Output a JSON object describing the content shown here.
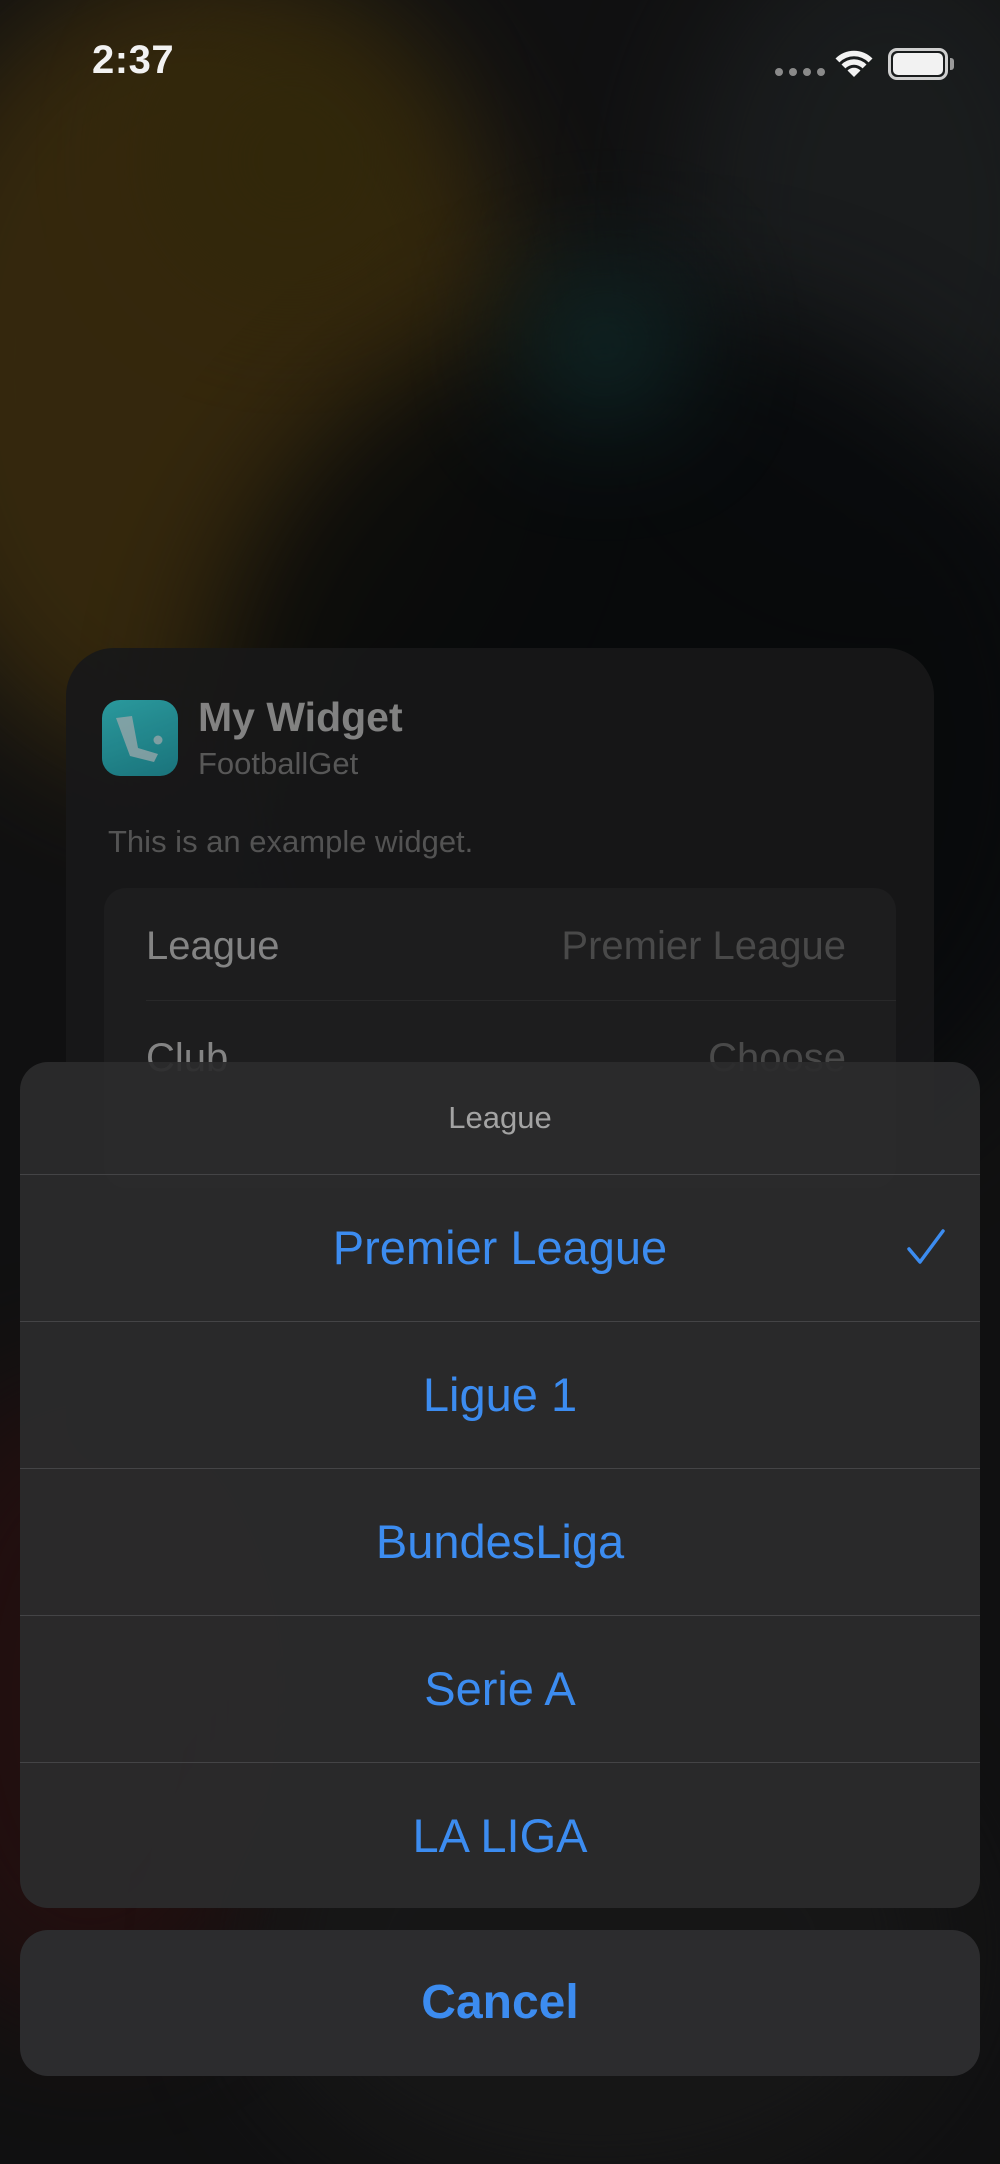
{
  "status_bar": {
    "time": "2:37"
  },
  "widget": {
    "name": "My Widget",
    "app": "FootballGet",
    "description": "This is an example widget.",
    "settings": [
      {
        "label": "League",
        "value": "Premier League"
      },
      {
        "label": "Club",
        "value": "Choose"
      }
    ]
  },
  "action_sheet": {
    "title": "League",
    "options": [
      {
        "label": "Premier League",
        "selected": true
      },
      {
        "label": "Ligue 1",
        "selected": false
      },
      {
        "label": "BundesLiga",
        "selected": false
      },
      {
        "label": "Serie A",
        "selected": false
      },
      {
        "label": "LA LIGA",
        "selected": false
      }
    ],
    "cancel_label": "Cancel"
  },
  "colors": {
    "accent": "#3c8cf0",
    "sheet_background": "#2b2b2c",
    "app_icon": "#2aa3a9"
  },
  "icons": {
    "wifi": "wifi-icon",
    "battery": "battery-icon",
    "signal": "signal-dots-icon",
    "check": "checkmark-icon",
    "app": "footballget-app-icon"
  }
}
